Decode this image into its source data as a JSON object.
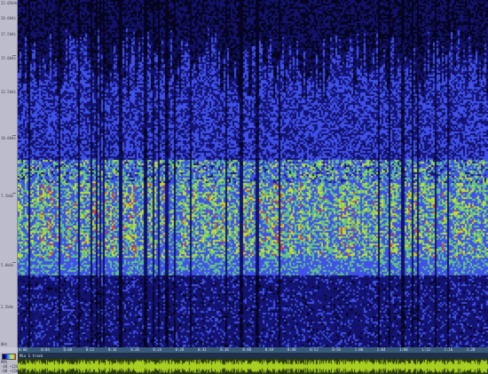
{
  "frequency_axis": {
    "labels": [
      "22.05kHz",
      "20.0kHz",
      "17.5kHz",
      "15.0kHz",
      "12.5kHz",
      "10.0kHz",
      "7.5kHz",
      "5.0kHz",
      "2.5kHz",
      "0Hz"
    ]
  },
  "time_ruler": {
    "labels": [
      "0:00",
      "0:04",
      "0:08",
      "0:12",
      "0:16",
      "0:20",
      "0:24",
      "0:28",
      "0:32",
      "0:36",
      "0:40",
      "0:44",
      "0:48",
      "0:52",
      "0:56",
      "1:00",
      "1:04",
      "1:08",
      "1:12",
      "1:16",
      "1:20"
    ]
  },
  "track": {
    "name": "Mix 1 track"
  },
  "status": {
    "label": "RMS",
    "values": [
      "-48 ~12dB",
      "-60 ~12dB"
    ]
  },
  "colors": {
    "background": "#050520",
    "low": "#1a1aa8",
    "mid": "#66cc88",
    "high": "#ccee33",
    "peak": "#ff4411",
    "waveform": "#a8d020"
  },
  "icons": {
    "color_legend": "gradient-legend-icon"
  }
}
